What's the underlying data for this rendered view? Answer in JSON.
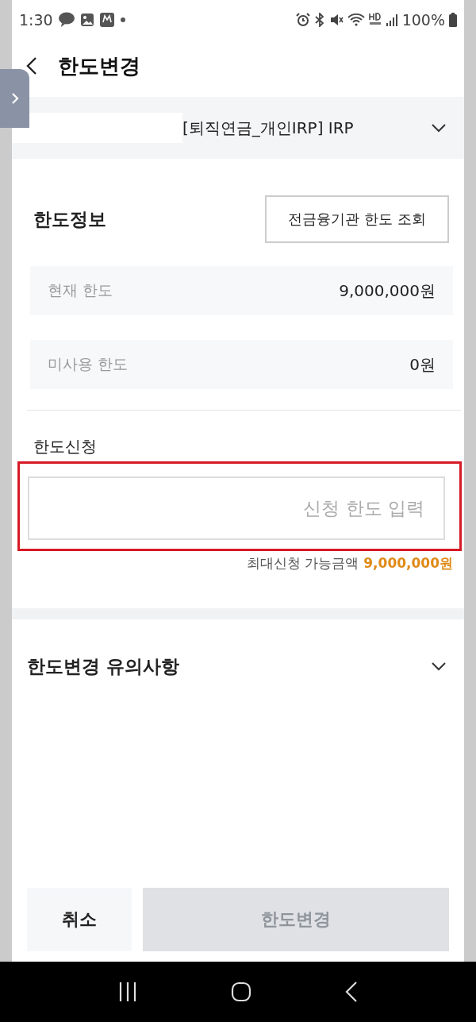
{
  "status_bar": {
    "time": "1:30",
    "battery": "100%"
  },
  "header": {
    "title": "한도변경"
  },
  "account": {
    "name": "[퇴직연금_개인IRP] IRP",
    "expanded": false
  },
  "limit_info": {
    "title": "한도정보",
    "lookup_button": "전금융기관 한도 조회",
    "rows": [
      {
        "label": "현재 한도",
        "value": "9,000,000원"
      },
      {
        "label": "미사용 한도",
        "value": "0원"
      }
    ]
  },
  "application": {
    "label": "한도신청",
    "placeholder": "신청 한도 입력",
    "highlighted": true,
    "max_label": "최대신청 가능금액",
    "max_amount": "9,000,000원"
  },
  "notice": {
    "title": "한도변경 유의사항",
    "expanded": false
  },
  "buttons": [
    {
      "label": "취소",
      "kind": "secondary",
      "disabled": false
    },
    {
      "label": "한도변경",
      "kind": "primary",
      "disabled": true
    }
  ]
}
